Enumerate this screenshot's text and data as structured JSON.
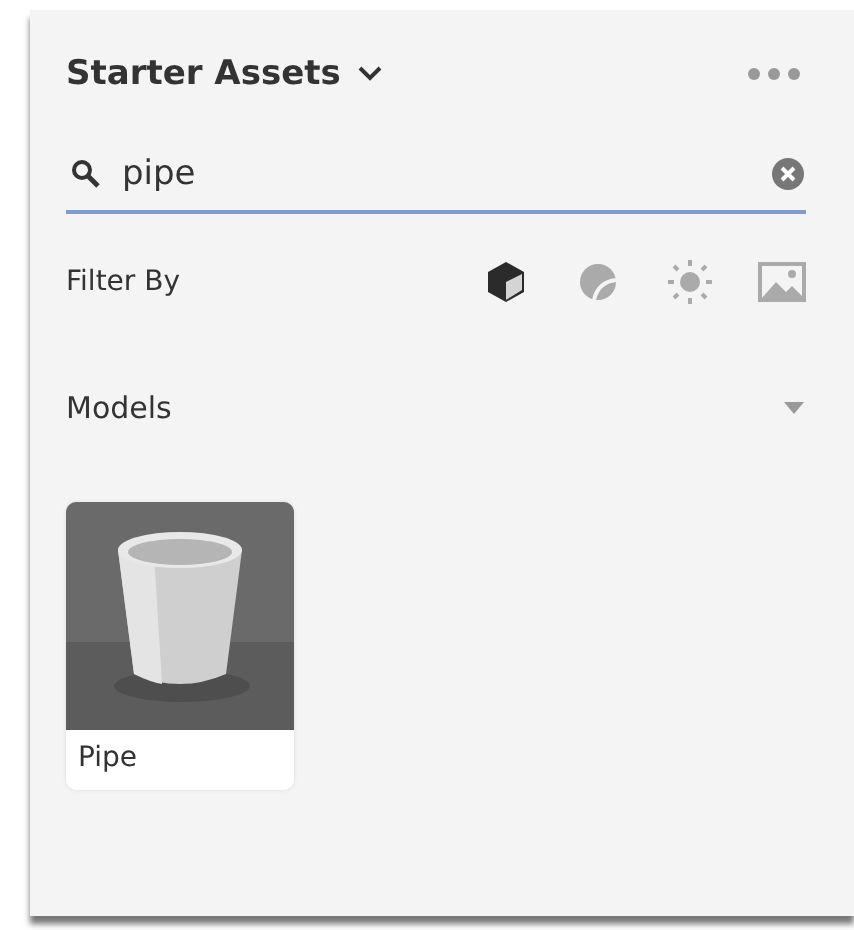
{
  "panel": {
    "title": "Starter Assets"
  },
  "search": {
    "value": "pipe"
  },
  "filter": {
    "label": "Filter By",
    "options": [
      {
        "kind": "models",
        "selected": true
      },
      {
        "kind": "materials",
        "selected": false
      },
      {
        "kind": "lights",
        "selected": false
      },
      {
        "kind": "images",
        "selected": false
      }
    ]
  },
  "section": {
    "title": "Models",
    "expanded": true
  },
  "assets": [
    {
      "name": "Pipe"
    }
  ]
}
